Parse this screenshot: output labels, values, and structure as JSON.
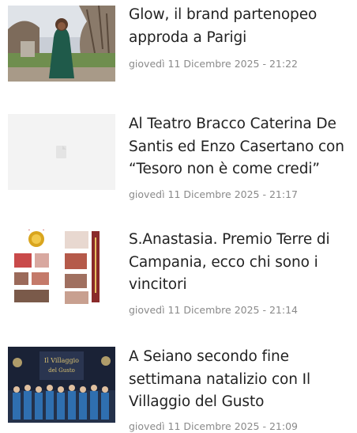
{
  "articles": [
    {
      "title": "Glow, il brand partenopeo approda a Parigi",
      "date": "giovedì 11 Dicembre 2025 - 21:22",
      "thumb_icon": "photo-woman-green-dress"
    },
    {
      "title": "Al Teatro Bracco Caterina De Santis ed Enzo Casertano con “Tesoro non è come credi”",
      "date": "giovedì 11 Dicembre 2025 - 21:17",
      "thumb_icon": "image-placeholder-icon"
    },
    {
      "title": "S.Anastasia. Premio Terre di Campania, ecco chi sono i vincitori",
      "date": "giovedì 11 Dicembre 2025 - 21:14",
      "thumb_icon": "photo-award-collage"
    },
    {
      "title": "A Seiano secondo fine settimana natalizio con Il Villaggio del Gusto",
      "date": "giovedì 11 Dicembre 2025 - 21:09",
      "thumb_icon": "photo-choir-stage"
    }
  ],
  "colors": {
    "title": "#222222",
    "date": "#8a8a8a",
    "placeholder_bg": "#f3f3f3"
  }
}
